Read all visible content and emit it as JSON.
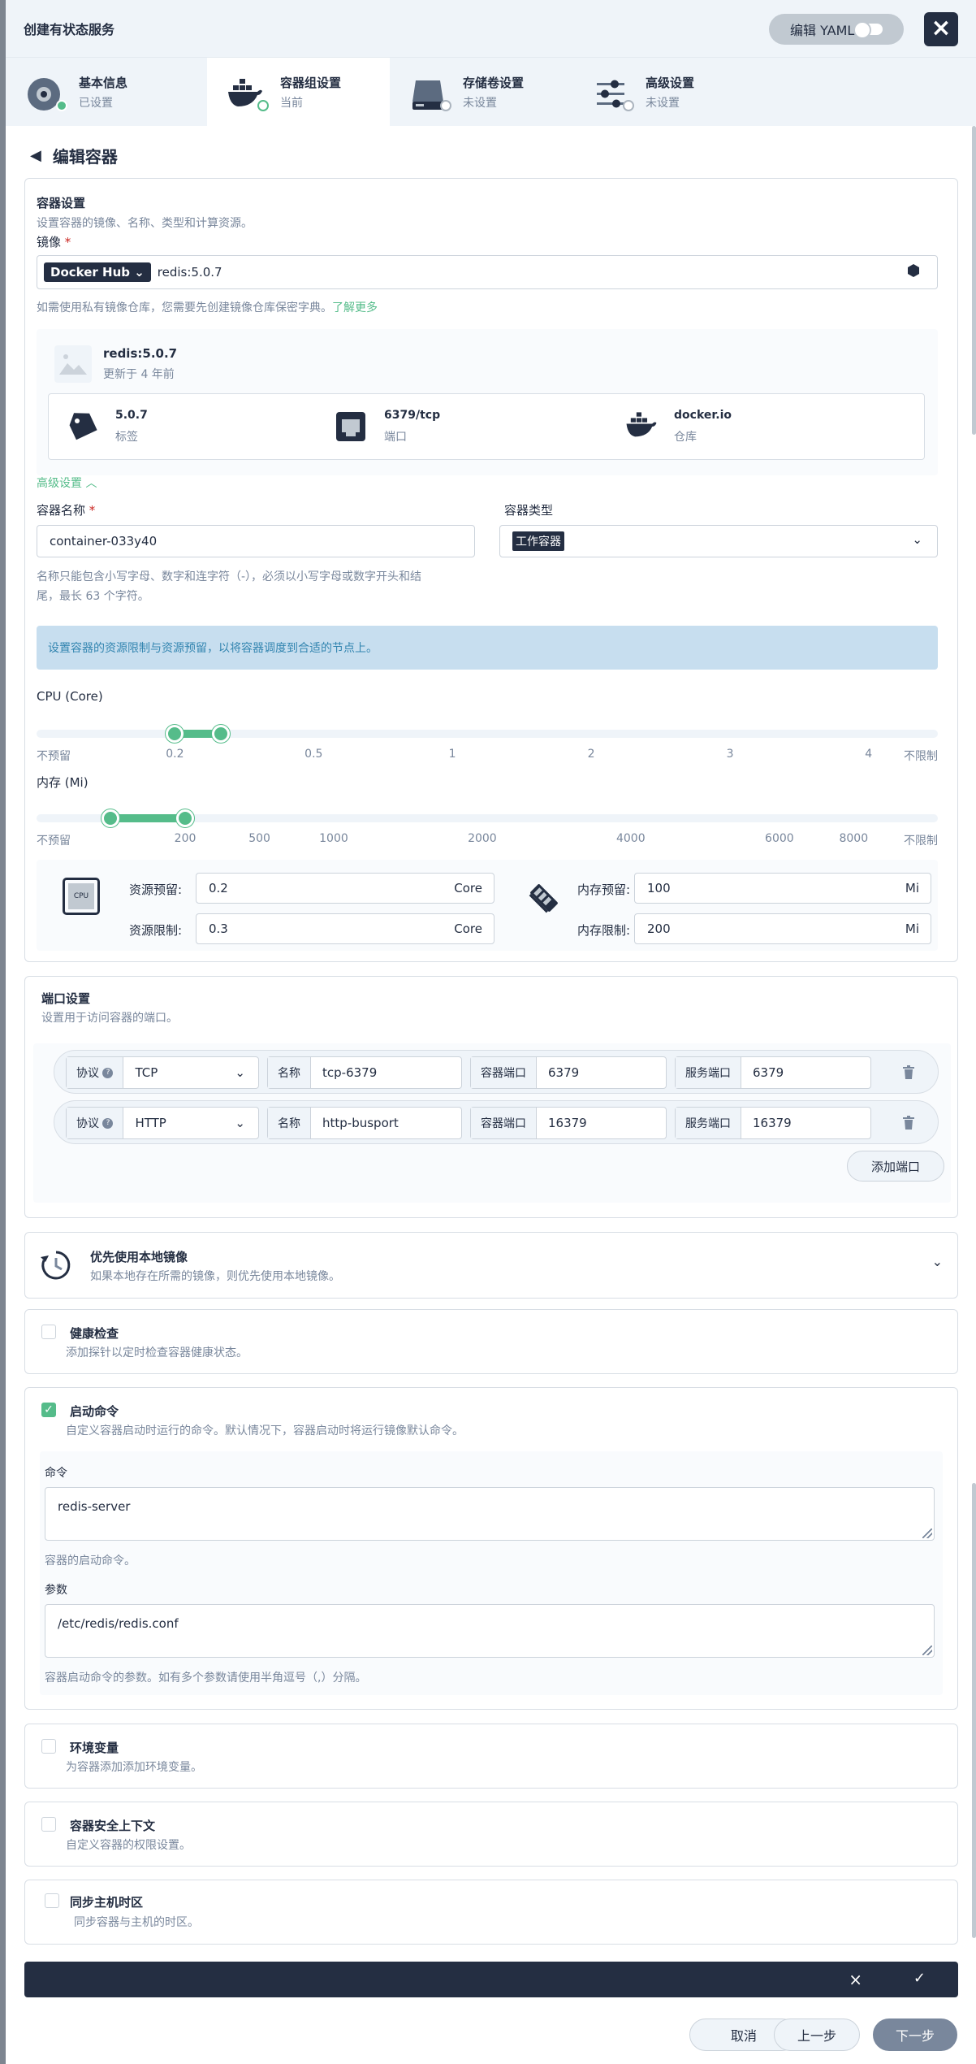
{
  "header": {
    "title": "创建有状态服务",
    "yaml_label": "编辑 YAML"
  },
  "steps": [
    {
      "title": "基本信息",
      "status": "已设置"
    },
    {
      "title": "容器组设置",
      "status": "当前"
    },
    {
      "title": "存储卷设置",
      "status": "未设置"
    },
    {
      "title": "高级设置",
      "status": "未设置"
    }
  ],
  "page_title": "编辑容器",
  "container": {
    "section_title": "容器设置",
    "section_desc": "设置容器的镜像、名称、类型和计算资源。",
    "image_label": "镜像",
    "registry": "Docker Hub",
    "image_value": "redis:5.0.7",
    "private_hint": "如需使用私有镜像仓库，您需要先创建镜像仓库保密字典。",
    "learn_more": "了解更多",
    "image_name": "redis:5.0.7",
    "image_updated": "更新于 4 年前",
    "tag_value": "5.0.7",
    "tag_label": "标签",
    "port_value": "6379/tcp",
    "port_label": "端口",
    "repo_value": "docker.io",
    "repo_label": "仓库",
    "advanced_label": "高级设置",
    "name_label": "容器名称",
    "name_value": "container-033y40",
    "type_label": "容器类型",
    "type_value": "工作容器",
    "name_hint1": "名称只能包含小写字母、数字和连字符（-），必须以小写字母或数字开头和结",
    "name_hint2": "尾，最长 63 个字符。",
    "resource_tip": "设置容器的资源限制与资源预留，以将容器调度到合适的节点上。",
    "cpu_label": "CPU (Core)",
    "cpu_ticks": [
      "不预留",
      "0.2",
      "0.5",
      "1",
      "2",
      "3",
      "4",
      "不限制"
    ],
    "cpu_request": 0.2,
    "cpu_limit": 0.3,
    "mem_label": "内存 (Mi)",
    "mem_ticks": [
      "不预留",
      "200",
      "500",
      "1000",
      "2000",
      "4000",
      "6000",
      "8000",
      "不限制"
    ],
    "mem_request": 100,
    "mem_limit": 200,
    "cpu_icon_text": "CPU",
    "res_request_label": "资源预留:",
    "res_limit_label": "资源限制:",
    "cpu_request_value": "0.2",
    "cpu_limit_value": "0.3",
    "cpu_unit": "Core",
    "mem_request_label": "内存预留:",
    "mem_limit_label": "内存限制:",
    "mem_request_value": "100",
    "mem_limit_value": "200",
    "mem_unit": "Mi"
  },
  "ports": {
    "section_title": "端口设置",
    "section_desc": "设置用于访问容器的端口。",
    "protocol_label": "协议",
    "name_label": "名称",
    "container_port_label": "容器端口",
    "service_port_label": "服务端口",
    "rows": [
      {
        "protocol": "TCP",
        "name": "tcp-6379",
        "container_port": "6379",
        "service_port": "6379"
      },
      {
        "protocol": "HTTP",
        "name": "http-busport",
        "container_port": "16379",
        "service_port": "16379"
      }
    ],
    "add_label": "添加端口"
  },
  "local_image": {
    "title": "优先使用本地镜像",
    "desc": "如果本地存在所需的镜像，则优先使用本地镜像。"
  },
  "health": {
    "title": "健康检查",
    "desc": "添加探针以定时检查容器健康状态。"
  },
  "startup": {
    "title": "启动命令",
    "desc": "自定义容器启动时运行的命令。默认情况下，容器启动时将运行镜像默认命令。",
    "command_label": "命令",
    "command_value": "redis-server",
    "command_hint": "容器的启动命令。",
    "args_label": "参数",
    "args_value": "/etc/redis/redis.conf",
    "args_hint": "容器启动命令的参数。如有多个参数请使用半角逗号（,）分隔。"
  },
  "env": {
    "title": "环境变量",
    "desc": "为容器添加添加环境变量。"
  },
  "security": {
    "title": "容器安全上下文",
    "desc": "自定义容器的权限设置。"
  },
  "timezone": {
    "title": "同步主机时区",
    "desc": "同步容器与主机的时区。"
  },
  "footer": {
    "cancel": "取消",
    "prev": "上一步",
    "next": "下一步"
  },
  "colors": {
    "accent": "#55bc8a",
    "dark": "#242e42",
    "muted": "#79879c"
  }
}
